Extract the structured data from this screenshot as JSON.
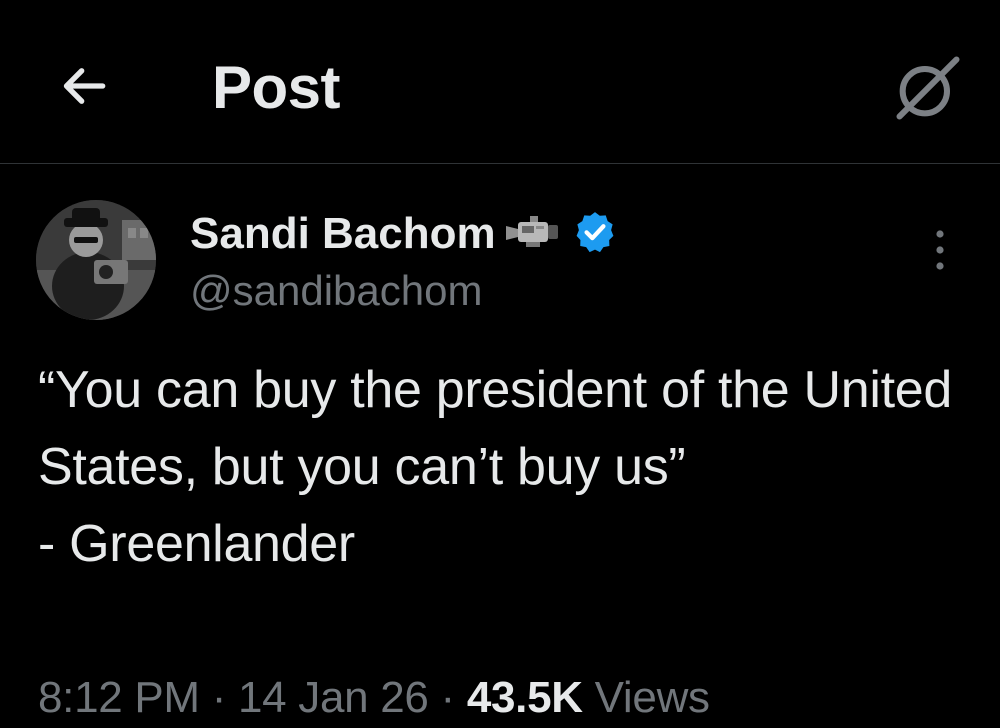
{
  "header": {
    "title": "Post",
    "back_icon": "arrow-left-icon",
    "grok_icon": "grok-icon"
  },
  "post": {
    "author": {
      "display_name": "Sandi Bachom",
      "name_emoji": "📹",
      "verified": true,
      "verified_color": "#1d9bf0",
      "handle": "@sandibachom"
    },
    "text": {
      "line1": "“You can buy the president of the United States, but you can’t buy us”",
      "line2": "- Greenlander"
    },
    "meta": {
      "time": "8:12 PM",
      "separator": "·",
      "date": "14 Jan 26",
      "views_count": "43.5K",
      "views_label": "Views"
    }
  },
  "colors": {
    "background": "#000000",
    "text_primary": "#e7e9ea",
    "text_secondary": "#71767b",
    "divider": "#2f3336"
  }
}
